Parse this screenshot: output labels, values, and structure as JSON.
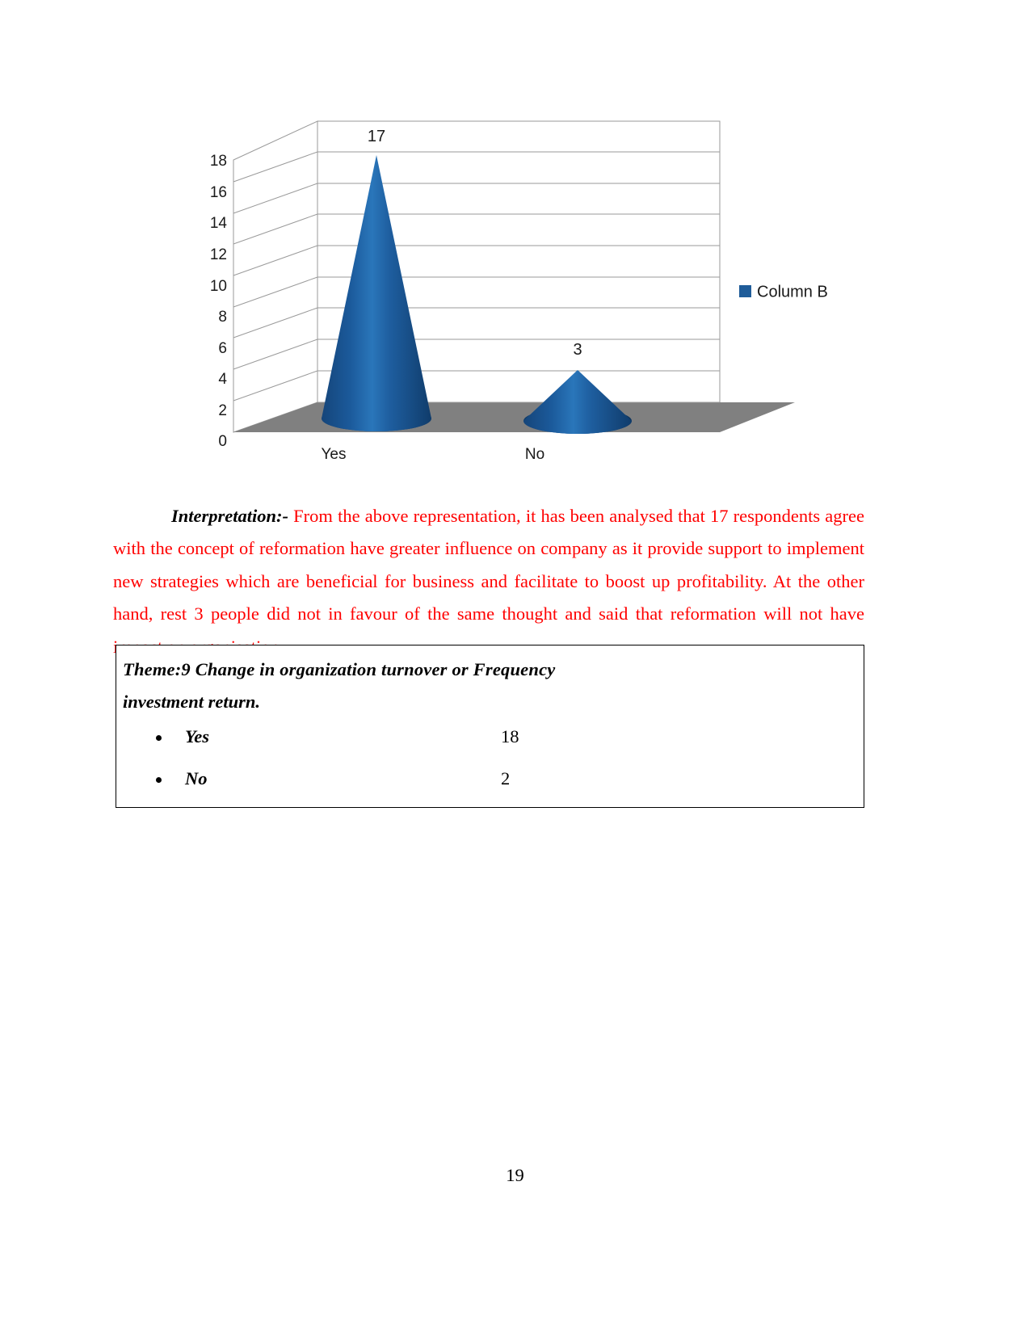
{
  "chart_data": {
    "type": "bar",
    "chart_style": "3d-cone",
    "title": "",
    "categories": [
      "Yes",
      "No"
    ],
    "values": [
      17,
      3
    ],
    "data_labels": [
      "17",
      "3"
    ],
    "series": [
      {
        "name": "Column B",
        "values": [
          17,
          3
        ]
      }
    ],
    "legend": {
      "entries": [
        "Column B"
      ],
      "position": "right"
    },
    "xlabel": "",
    "ylabel": "",
    "ylim": [
      0,
      18
    ],
    "ytick_step": 2,
    "ytick_labels": [
      "18",
      "16",
      "14",
      "12",
      "10",
      "8",
      "6",
      "4",
      "2",
      "0"
    ],
    "grid": true,
    "colors": {
      "series_fill": "#1F5C99",
      "series_fill_dark": "#174B80",
      "series_highlight": "#2E7AC0",
      "floor": "#808080",
      "wall": "#FFFFFF",
      "gridline": "#9A9A9A"
    }
  },
  "interpretation": {
    "lead": "Interpretation:-",
    "body": " From the above representation, it has been analysed that 17 respondents agree with the concept of reformation have greater influence on company as it provide support to implement new strategies which are beneficial for business and facilitate to boost up profitability. At the other hand,  rest 3 people did not in favour of the same thought and said that reformation will not have impact on organisation."
  },
  "theme_box": {
    "heading_line1": "Theme:9 Change in organization turnover or  Frequency",
    "heading_line2": "investment return.",
    "rows": [
      {
        "label": "Yes",
        "value": "18"
      },
      {
        "label": "No",
        "value": "2"
      }
    ]
  },
  "footer": {
    "page_number": "19"
  }
}
